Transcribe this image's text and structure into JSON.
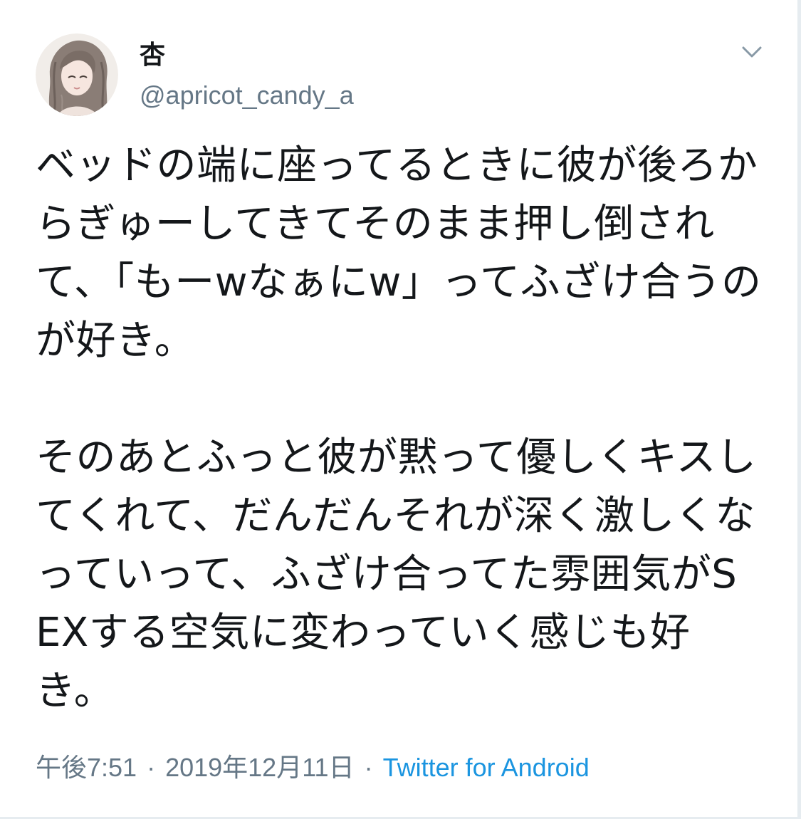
{
  "tweet": {
    "display_name": "杏",
    "handle": "@apricot_candy_a",
    "text": "ベッドの端に座ってるときに彼が後ろからぎゅーしてきてそのまま押し倒されて、「もーwなぁにw」ってふざけ合うのが好き。\n\nそのあとふっと彼が黙って優しくキスしてくれて、だんだんそれが深く激しくなっていって、ふざけ合ってた雰囲気がSEXする空気に変わっていく感じも好き。",
    "time": "午後7:51",
    "date": "2019年12月11日",
    "separator": "·",
    "source": "Twitter for Android"
  },
  "icons": {
    "avatar": "avatar-illustration",
    "caret": "chevron-down-icon"
  },
  "colors": {
    "text": "#14171a",
    "secondary": "#657786",
    "link": "#1b95e0",
    "border": "#e6ecf0"
  }
}
